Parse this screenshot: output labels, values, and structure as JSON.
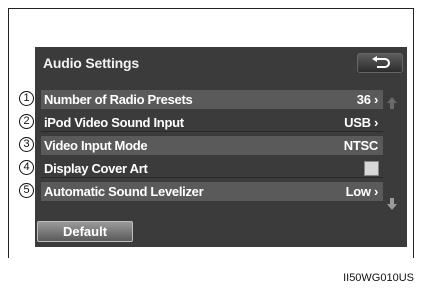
{
  "screen": {
    "title": "Audio Settings",
    "back_icon": "return-arrow-icon",
    "rows": [
      {
        "callout": "1",
        "label": "Number of Radio Presets",
        "value": "36 ›"
      },
      {
        "callout": "2",
        "label": "iPod Video Sound Input",
        "value": "USB ›"
      },
      {
        "callout": "3",
        "label": "Video Input Mode",
        "value": "NTSC"
      },
      {
        "callout": "4",
        "label": "Display Cover Art",
        "checked": true
      },
      {
        "callout": "5",
        "label": "Automatic Sound Levelizer",
        "value": "Low ›"
      }
    ],
    "default_label": "Default",
    "scroll_up_icon": "scroll-up-icon",
    "scroll_down_icon": "scroll-down-icon"
  },
  "figure_code": "II50WG010US"
}
